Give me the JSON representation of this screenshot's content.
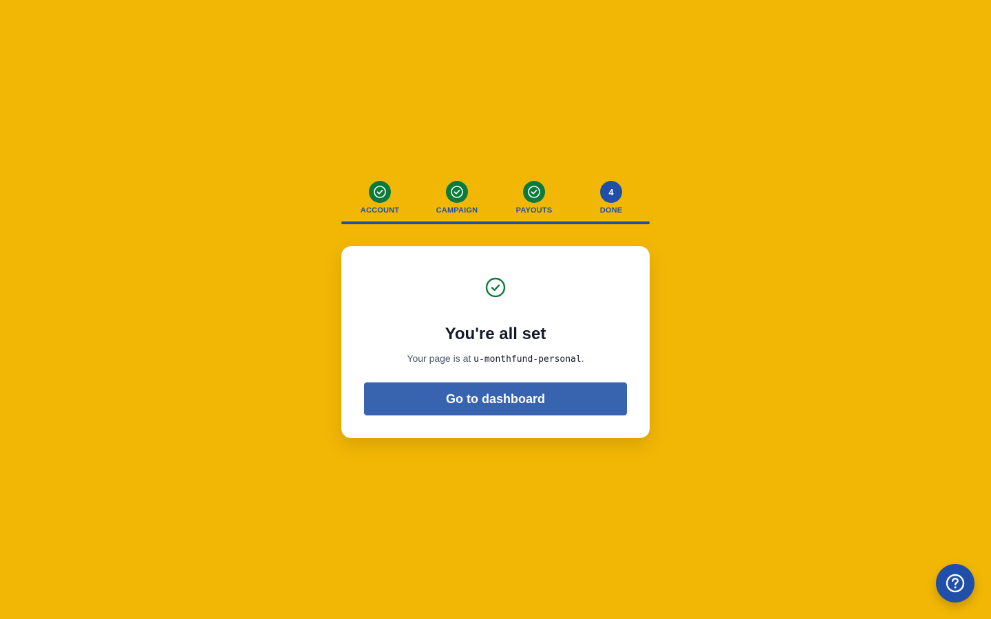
{
  "stepper": {
    "steps": [
      {
        "label": "ACCOUNT",
        "state": "complete",
        "icon": "check-circle-icon"
      },
      {
        "label": "CAMPAIGN",
        "state": "complete",
        "icon": "check-circle-icon"
      },
      {
        "label": "PAYOUTS",
        "state": "complete",
        "icon": "check-circle-icon"
      },
      {
        "label": "DONE",
        "state": "current",
        "number": "4"
      }
    ],
    "progress_fraction": 1.0
  },
  "card": {
    "icon": "check-circle-icon",
    "title": "You're all set",
    "subtitle_prefix": "Your page is at ",
    "page_slug": "u-monthfund-personal",
    "subtitle_suffix": ".",
    "button_label": "Go to dashboard"
  },
  "help": {
    "icon": "help-circle-icon"
  },
  "colors": {
    "background": "#F2B705",
    "brand_blue": "#1F4FA8",
    "button_blue": "#3863AF",
    "success_green": "#0B7A3B",
    "title_text": "#141A2A"
  }
}
